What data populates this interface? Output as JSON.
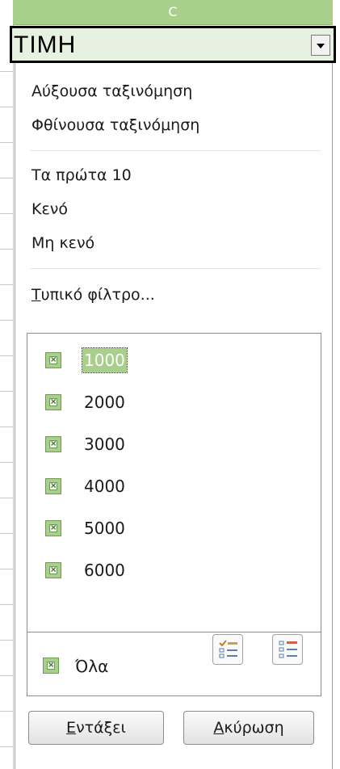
{
  "sheet": {
    "column_letter": "C",
    "header_cell_text": "ΤΙΜΗ"
  },
  "menu": {
    "sort_ascending": "Αύξουσα ταξινόμηση",
    "sort_descending": "Φθίνουσα ταξινόμηση",
    "top_10": "Τα πρώτα 10",
    "empty": "Κενό",
    "not_empty": "Μη κενό",
    "standard_filter_first": "Τ",
    "standard_filter_rest": "υπικό φίλτρο..."
  },
  "values": [
    {
      "label": "1000",
      "checked": true,
      "focused": true
    },
    {
      "label": "2000",
      "checked": true
    },
    {
      "label": "3000",
      "checked": true
    },
    {
      "label": "4000",
      "checked": true
    },
    {
      "label": "5000",
      "checked": true
    },
    {
      "label": "6000",
      "checked": true
    }
  ],
  "all_label": "Όλα",
  "buttons": {
    "ok_first": "Ε",
    "ok_rest": "ντάξει",
    "cancel_first": "Α",
    "cancel_rest": "κύρωση"
  },
  "icons": {
    "dropdown": "chevron-down-icon",
    "select_all": "select-all-icon",
    "deselect_all": "deselect-all-icon"
  },
  "colors": {
    "accent": "#a9cf8c",
    "header_cell_bg": "#e7f1df"
  }
}
